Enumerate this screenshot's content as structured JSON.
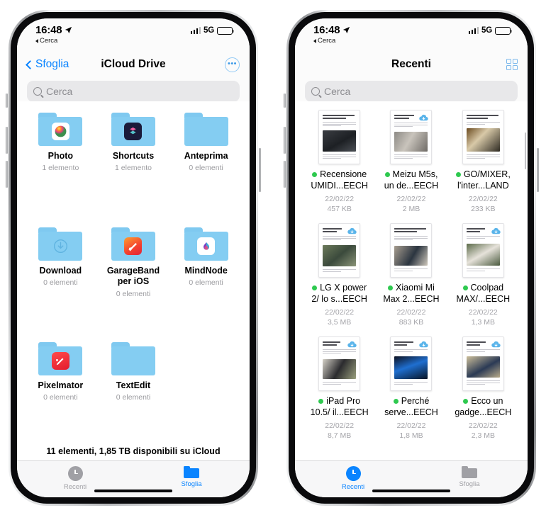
{
  "status_bar": {
    "time": "16:48",
    "back_label": "Cerca",
    "network": "5G",
    "location_icon": "location-arrow-icon",
    "signal_icon": "cellular-signal-icon",
    "battery_icon": "battery-icon"
  },
  "left_phone": {
    "nav": {
      "back_label": "Sfoglia",
      "title": "iCloud Drive",
      "more_label": "•••",
      "more_icon": "ellipsis-circle-icon"
    },
    "search": {
      "placeholder": "Cerca",
      "icon": "search-icon"
    },
    "folders": [
      {
        "name": "Photo",
        "count": "1 elemento",
        "badge": "photos-app-icon"
      },
      {
        "name": "Shortcuts",
        "count": "1 elemento",
        "badge": "shortcuts-app-icon"
      },
      {
        "name": "Anteprima",
        "count": "0 elementi",
        "badge": "none"
      },
      {
        "name": "Download",
        "count": "0 elementi",
        "badge": "download-arrow-icon"
      },
      {
        "name": "GarageBand per iOS",
        "count": "0 elementi",
        "badge": "garageband-app-icon"
      },
      {
        "name": "MindNode",
        "count": "0 elementi",
        "badge": "mindnode-app-icon"
      },
      {
        "name": "Pixelmator",
        "count": "0 elementi",
        "badge": "pixelmator-app-icon"
      },
      {
        "name": "TextEdit",
        "count": "0 elementi",
        "badge": "none"
      }
    ],
    "footer": "11 elementi, 1,85 TB disponibili su iCloud",
    "tabs": [
      {
        "label": "Recenti",
        "icon": "clock-icon",
        "active": false
      },
      {
        "label": "Sfoglia",
        "icon": "folder-icon",
        "active": true
      }
    ]
  },
  "right_phone": {
    "nav": {
      "title": "Recenti",
      "grid_icon": "grid-view-icon"
    },
    "search": {
      "placeholder": "Cerca",
      "icon": "search-icon"
    },
    "documents": [
      {
        "line1": "Recensione",
        "line2": "UMIDI...EECH",
        "date": "22/02/22",
        "size": "457 KB",
        "status": "downloaded",
        "cloud": false
      },
      {
        "line1": "Meizu M5s,",
        "line2": "un de...EECH",
        "date": "22/02/22",
        "size": "2 MB",
        "status": "downloaded",
        "cloud": true
      },
      {
        "line1": "GO/MIXER,",
        "line2": "l'inter...LAND",
        "date": "22/02/22",
        "size": "233 KB",
        "status": "downloaded",
        "cloud": false
      },
      {
        "line1": "LG X power",
        "line2": "2/ lo s...EECH",
        "date": "22/02/22",
        "size": "3,5 MB",
        "status": "downloaded",
        "cloud": true
      },
      {
        "line1": "Xiaomi Mi",
        "line2": "Max 2...EECH",
        "date": "22/02/22",
        "size": "883 KB",
        "status": "downloaded",
        "cloud": false
      },
      {
        "line1": "Coolpad",
        "line2": "MAX/...EECH",
        "date": "22/02/22",
        "size": "1,3 MB",
        "status": "downloaded",
        "cloud": true
      },
      {
        "line1": "iPad Pro",
        "line2": "10.5/ il...EECH",
        "date": "22/02/22",
        "size": "8,7 MB",
        "status": "downloaded",
        "cloud": true
      },
      {
        "line1": "Perché",
        "line2": "serve...EECH",
        "date": "22/02/22",
        "size": "1,8 MB",
        "status": "downloaded",
        "cloud": true
      },
      {
        "line1": "Ecco un",
        "line2": "gadge...EECH",
        "date": "22/02/22",
        "size": "2,3 MB",
        "status": "downloaded",
        "cloud": true
      }
    ],
    "tabs": [
      {
        "label": "Recenti",
        "icon": "clock-icon",
        "active": true
      },
      {
        "label": "Sfoglia",
        "icon": "folder-icon",
        "active": false
      }
    ]
  },
  "colors": {
    "accent_blue": "#0a84ff",
    "folder_blue": "#84cdf2",
    "status_green": "#2ec94f",
    "muted_gray": "#a4a4a9"
  }
}
